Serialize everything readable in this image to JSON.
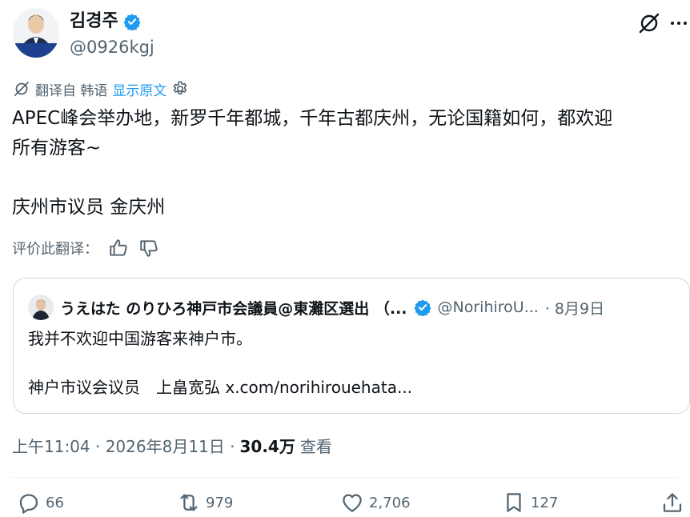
{
  "author": {
    "display_name": "김경주",
    "handle": "@0926kgj",
    "avatar_banner_text": "김경주"
  },
  "translate": {
    "label": "翻译自 韩语",
    "show_original": "显示原文"
  },
  "tweet": {
    "line1": "APEC峰会举办地，新罗千年都城，千年古都庆州，无论国籍如何，都欢迎",
    "line2": "所有游客~",
    "line3": "庆州市议员 金庆州"
  },
  "rate": {
    "label": "评价此翻译："
  },
  "quote": {
    "name": "うえはた のりひろ神戸市会議員@東灘区選出 （...",
    "handle": "@NorihiroU...",
    "date": "· 8月9日",
    "line1": "我并不欢迎中国游客来神户市。",
    "line2": "神户市议会议员　上畠宽弘 x.com/norihirouehata..."
  },
  "meta": {
    "time": "上午11:04 · 2026年8月11日 ·",
    "views_count": "30.4万",
    "views_label": "查看"
  },
  "actions": {
    "replies": "66",
    "reposts": "979",
    "likes": "2,706",
    "bookmarks": "127"
  },
  "colors": {
    "accent": "#1d9bf0",
    "secondary_text": "#536471",
    "primary_text": "#0f1419",
    "border": "#cfd9de"
  },
  "icons": [
    "verified-badge-icon",
    "grok-icon",
    "more-icon",
    "translate-icon",
    "gear-icon",
    "thumbs-up-icon",
    "thumbs-down-icon",
    "reply-icon",
    "repost-icon",
    "like-icon",
    "bookmark-icon",
    "share-icon"
  ]
}
